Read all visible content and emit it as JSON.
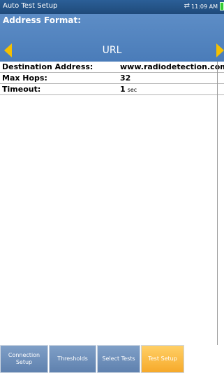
{
  "status_bar": {
    "title": "Auto Test Setup",
    "time": "11:09 AM",
    "link_icon": "network-link-icon",
    "battery_icon": "battery-icon",
    "battery_color": "#33cc33"
  },
  "address_format": {
    "label": "Address Format:",
    "value": "URL",
    "prev_icon": "arrow-left-icon",
    "next_icon": "arrow-right-icon",
    "arrow_color": "#f5c000"
  },
  "parameters": {
    "destination_address": {
      "label": "Destination Address:",
      "value": "www.radiodetection.com"
    },
    "max_hops": {
      "label": "Max Hops:",
      "value": "32"
    },
    "timeout": {
      "label": "Timeout:",
      "value": "1",
      "unit": "sec"
    }
  },
  "tabs": [
    {
      "label": "Connection\nSetup",
      "active": false
    },
    {
      "label": "Thresholds",
      "active": false
    },
    {
      "label": "Select Tests",
      "active": false
    },
    {
      "label": "Test Setup",
      "active": true
    }
  ],
  "colors": {
    "header_blue": "#4a7cb9",
    "status_blue": "#1f4a7a",
    "tab_blue": "#6d8fbb",
    "tab_active": "#f6a92a"
  }
}
